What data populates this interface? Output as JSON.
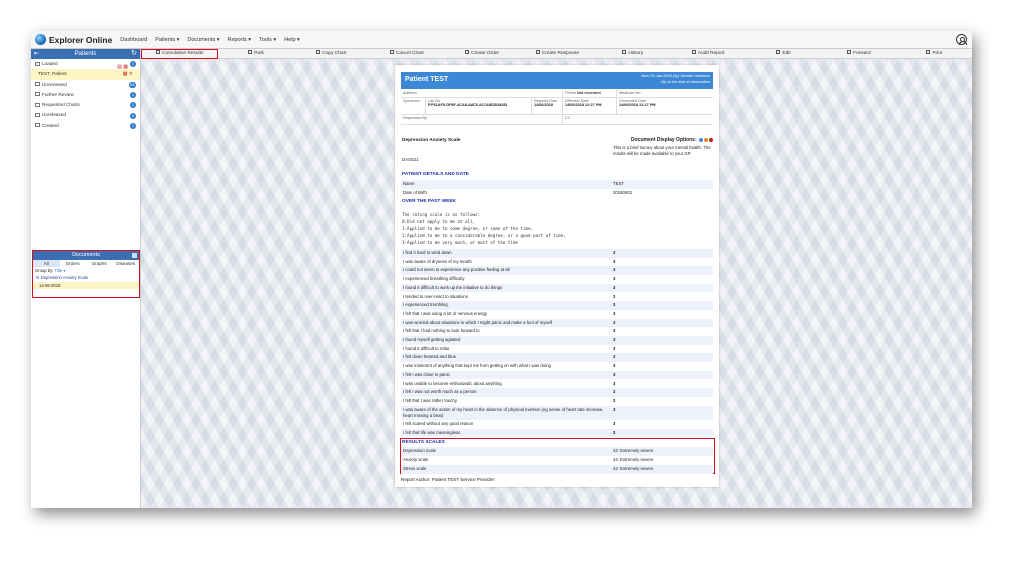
{
  "app": {
    "title": "Explorer Online"
  },
  "nav": [
    "Dashboard",
    "Patients ▾",
    "Documents ▾",
    "Reports ▾",
    "Tools ▾",
    "Help ▾"
  ],
  "sidebar": {
    "header": "Patients",
    "items": [
      {
        "label": "Loaded",
        "badge": "1"
      },
      {
        "label": "Unreviewed",
        "badge": "58"
      },
      {
        "label": "Further Review",
        "badge": "1"
      },
      {
        "label": "Requested Charts",
        "badge": "1"
      },
      {
        "label": "Unreleased",
        "badge": "0"
      },
      {
        "label": "Created",
        "badge": "1"
      }
    ],
    "loaded_patient": "TEST, Patient"
  },
  "documents": {
    "header": "Documents",
    "tabs": [
      "All",
      "Orders",
      "Graphs",
      "Diseases"
    ],
    "group_by_label": "Group by:",
    "group_by_value": "Title ▾",
    "item": "Depression Anxiety Scale",
    "item_date": "14-06-2018"
  },
  "toolbar": [
    "Cumulative Results",
    "Park",
    "Copy Chart",
    "Cancel Chart",
    "Create Order",
    "Create Response",
    "History",
    "Audit Report",
    "Edit",
    "Forward",
    "Print"
  ],
  "report": {
    "patient_name": "Patient TEST",
    "dob_line": "Born 01-Jan-2018 (3y) Gender Unknown",
    "age_note": "My at the time of observation",
    "address_lbl": "Address",
    "phone_lbl": "Phone",
    "phone_val": "Not recorded",
    "medicare_lbl": "Medicare No",
    "specimen_lbl": "Specimen",
    "lab_no_lbl": "Lab No",
    "lab_no": "F/F61AF5-DF8F-4CA8-A8C5-A17A8DDD8281",
    "req_date_lbl": "Request Date",
    "req_date": "14/06/2018",
    "eff_date_lbl": "Effective Date",
    "eff_date": "14/06/2018 12:27 PM",
    "gen_date_lbl": "Generated Date",
    "gen_date": "14/06/2018 12:27 PM",
    "requested_by_lbl": "Requested By",
    "cc_lbl": "CC",
    "section_title": "Depression Anxiety Scale",
    "doc_display_options": "Document Display Options:",
    "dass": "DASS21",
    "desc": "This is a brief survey about your mental health. The results will be made available to your GP.",
    "patient_details_hd": "PATIENT DETAILS AND DATE",
    "name_lbl": "Name",
    "name_val": "TEST",
    "dob_lbl": "Date of Birth",
    "dob_val": "20180601",
    "past_week_hd": "OVER THE PAST WEEK",
    "scale_note": "The rating scale is as follows:\n0:Did not apply to me at all,\n1:Applied to me to some degree, or some of the time,\n2:Applied to me to a considerable degree, or a good part of time,\n3:Applied to me very much, or most of the time",
    "questions": [
      {
        "q": "I find it hard to wind down",
        "a": "3"
      },
      {
        "q": "I was aware of dryness of my mouth",
        "a": "3"
      },
      {
        "q": "I could not seem to experience any positive feeling at all",
        "a": "3"
      },
      {
        "q": "I experienced breathing difficulty",
        "a": "3"
      },
      {
        "q": "I found it difficult to work up the initiative to do things",
        "a": "3"
      },
      {
        "q": "I tended to over-react to situations",
        "a": "3"
      },
      {
        "q": "I experienced trembling",
        "a": "3"
      },
      {
        "q": "I felt that I was using a lot of nervous energy",
        "a": "3"
      },
      {
        "q": "I was worried about situations in which I might panic and make a fool of myself",
        "a": "3"
      },
      {
        "q": "I felt that I had nothing to look forward to",
        "a": "3"
      },
      {
        "q": "I found myself getting agitated",
        "a": "3"
      },
      {
        "q": "I found it difficult to relax",
        "a": "3"
      },
      {
        "q": "I felt down hearted and blue",
        "a": "3"
      },
      {
        "q": "I was intolerant of anything that kept me from getting on with what I was doing",
        "a": "3"
      },
      {
        "q": "I felt I was close to panic",
        "a": "3"
      },
      {
        "q": "I was unable to become enthusiastic about anything",
        "a": "3"
      },
      {
        "q": "I felt I was not worth much as a person",
        "a": "3"
      },
      {
        "q": "I felt that I was rather touchy",
        "a": "3"
      },
      {
        "q": "I was aware of the action of my heart in the absence of physical exertion (eg sense of heart rate increase, heart missing a beat)",
        "a": "3"
      },
      {
        "q": "I felt scared without any good reason",
        "a": "3"
      },
      {
        "q": "I felt that life was meaningless",
        "a": "3"
      }
    ],
    "results_hd": "RESULTS SCALES",
    "results": [
      {
        "k": "Depression scale",
        "v": "42: Extremely severe"
      },
      {
        "k": "Anxiety scale",
        "v": "42: Extremely severe"
      },
      {
        "k": "Stress scale",
        "v": "42: Extremely severe"
      }
    ],
    "footer": "Report Author: Patient TEST     Service Provider:"
  }
}
